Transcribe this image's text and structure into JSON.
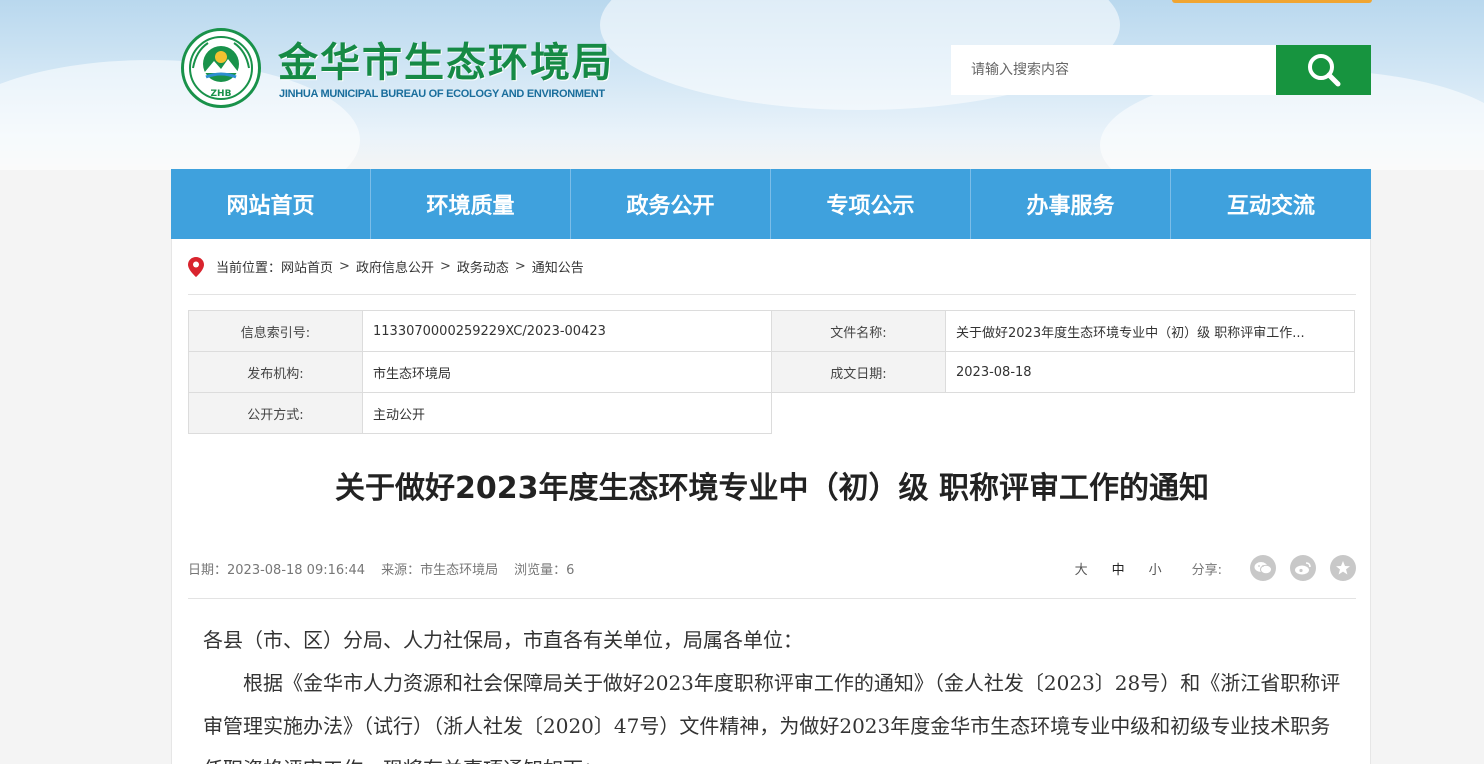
{
  "header": {
    "title": "金华市生态环境局",
    "subtitle": "JINHUA MUNICIPAL BUREAU OF ECOLOGY AND ENVIRONMENT",
    "emblem_text": "ZHB",
    "search_placeholder": "请输入搜索内容"
  },
  "colors": {
    "nav_blue": "#3fa1dd",
    "brand_green": "#17943f",
    "pin_red": "#d9242e"
  },
  "nav": {
    "items": [
      {
        "label": "网站首页"
      },
      {
        "label": "环境质量"
      },
      {
        "label": "政务公开"
      },
      {
        "label": "专项公示"
      },
      {
        "label": "办事服务"
      },
      {
        "label": "互动交流"
      }
    ]
  },
  "breadcrumb": {
    "prefix": "当前位置：",
    "items": [
      "网站首页",
      "政府信息公开",
      "政务动态",
      "通知公告"
    ],
    "separator": ">"
  },
  "info": {
    "index_label": "信息索引号:",
    "index_value": "1133070000259229XC/2023-00423",
    "filename_label": "文件名称:",
    "filename_value": "关于做好2023年度生态环境专业中（初）级 职称评审工作...",
    "publisher_label": "发布机构:",
    "publisher_value": "市生态环境局",
    "date_label": "成文日期:",
    "date_value": "2023-08-18",
    "open_label": "公开方式:",
    "open_value": "主动公开"
  },
  "article": {
    "title": "关于做好2023年度生态环境专业中（初）级 职称评审工作的通知",
    "meta": {
      "date": "日期：2023-08-18 09:16:44",
      "source": "来源：市生态环境局",
      "views": "浏览量：6",
      "font_large": "大",
      "font_medium": "中",
      "font_small": "小",
      "share_label": "分享:",
      "share_icons": [
        "wechat-icon",
        "weibo-icon",
        "favorite-icon"
      ]
    },
    "paragraphs": [
      "各县（市、区）分局、人力社保局，市直各有关单位，局属各单位：",
      "根据《金华市人力资源和社会保障局关于做好2023年度职称评审工作的通知》（金人社发〔2023〕28号）和《浙江省职称评审管理实施办法》（试行）（浙人社发〔2020〕47号）文件精神，为做好2023年度金华市生态环境专业中级和初级专业技术职务任职资格评审工作，现将有关事项通知如下："
    ]
  }
}
